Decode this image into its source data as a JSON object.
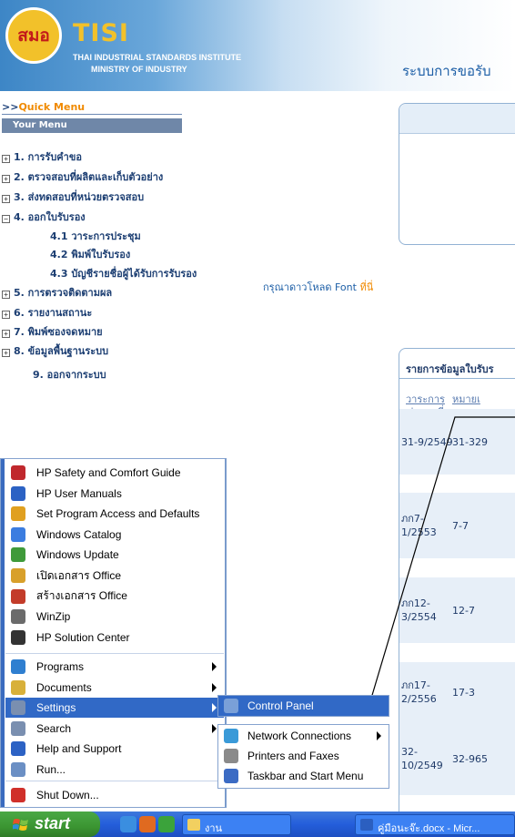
{
  "header": {
    "logo_text": "สมอ",
    "brand": "TISI",
    "institute": "THAI INDUSTRIAL STANDARDS INSTITUTE",
    "ministry": "MINISTRY OF INDUSTRY",
    "system_name": "ระบบการขอรับ"
  },
  "sidebar": {
    "quick_menu_prefix": ">>",
    "quick_menu": "Quick Menu",
    "your_menu": "Your Menu",
    "items": [
      {
        "label": "1. การรับคำขอ",
        "toggle": "+"
      },
      {
        "label": "2. ตรวจสอบที่ผลิตและเก็บตัวอย่าง",
        "toggle": "+"
      },
      {
        "label": "3. ส่งทดสอบที่หน่วยตรวจสอบ",
        "toggle": "+"
      },
      {
        "label": "4. ออกใบรับรอง",
        "toggle": "−"
      },
      {
        "label": "5. การตรวจติดตามผล",
        "toggle": "+"
      },
      {
        "label": "6. รายงานสถานะ",
        "toggle": "+"
      },
      {
        "label": "7. พิมพ์ซองจดหมาย",
        "toggle": "+"
      },
      {
        "label": "8. ข้อมูลพื้นฐานระบบ",
        "toggle": "+"
      },
      {
        "label": "9. ออกจากระบบ",
        "toggle": ""
      }
    ],
    "subitems": [
      "4.1 วาระการประชุม",
      "4.2 พิมพ์ใบรับรอง",
      "4.3 บัญชีรายชื่อผู้ได้รับการรับรอง"
    ]
  },
  "font_note": {
    "text": "กรุณาดาวโหลด Font ",
    "link": "ที่นี่"
  },
  "cert_panel": {
    "title": "รายการข้อมูลใบรับร",
    "columns": [
      [
        "วาระการ",
        "ประชุมที่"
      ],
      [
        "หมายเ",
        "เอกส"
      ]
    ],
    "rows": [
      {
        "c1": [
          "31-9/2549"
        ],
        "c2": "31-329"
      },
      {
        "c1": [
          "ภก7-",
          "1/2553"
        ],
        "c2": "7-7"
      },
      {
        "c1": [
          "ภก12-",
          "3/2554"
        ],
        "c2": "12-7"
      },
      {
        "c1": [
          "ภก17-",
          "2/2556"
        ],
        "c2": "17-3"
      },
      {
        "c1": [
          "32-",
          "10/2549"
        ],
        "c2": "32-965"
      }
    ]
  },
  "start_menu": {
    "pinned": [
      {
        "label": "HP Safety and Comfort Guide",
        "icon": "pdf-icon",
        "color": "#c0282d"
      },
      {
        "label": "HP User Manuals",
        "icon": "hp-icon",
        "color": "#2c62c4"
      },
      {
        "label": "Set Program Access and Defaults",
        "icon": "program-access-icon",
        "color": "#e0a020"
      },
      {
        "label": "Windows Catalog",
        "icon": "windows-catalog-icon",
        "color": "#3b7de0"
      },
      {
        "label": "Windows Update",
        "icon": "windows-update-icon",
        "color": "#3f9a3a"
      },
      {
        "label": "เปิดเอกสาร Office",
        "icon": "office-open-icon",
        "color": "#d8a02b"
      },
      {
        "label": "สร้างเอกสาร Office",
        "icon": "office-new-icon",
        "color": "#c33c2a"
      },
      {
        "label": "WinZip",
        "icon": "winzip-icon",
        "color": "#6b6b6b"
      },
      {
        "label": "HP Solution Center",
        "icon": "hp-solution-icon",
        "color": "#333333"
      }
    ],
    "main": [
      {
        "label": "Programs",
        "icon": "programs-icon",
        "color": "#2f7fd0",
        "arrow": true
      },
      {
        "label": "Documents",
        "icon": "documents-icon",
        "color": "#d8b03a",
        "arrow": true
      },
      {
        "label": "Settings",
        "icon": "settings-icon",
        "color": "#7a8fb0",
        "arrow": true
      },
      {
        "label": "Search",
        "icon": "search-icon",
        "color": "#7a8fb0",
        "arrow": true
      },
      {
        "label": "Help and Support",
        "icon": "help-icon",
        "color": "#2c62c4",
        "arrow": false
      },
      {
        "label": "Run...",
        "icon": "run-icon",
        "color": "#6b8fc4",
        "arrow": false
      }
    ],
    "shutdown": {
      "label": "Shut Down...",
      "icon": "shutdown-icon",
      "color": "#d0302a"
    }
  },
  "settings_submenu": {
    "items": [
      {
        "label": "Control Panel",
        "icon": "control-panel-icon",
        "color": "#7aa0d8",
        "arrow": false
      },
      {
        "label": "Network Connections",
        "icon": "network-icon",
        "color": "#3a9ad8",
        "arrow": true
      },
      {
        "label": "Printers and Faxes",
        "icon": "printer-icon",
        "color": "#8a8a8a",
        "arrow": false
      },
      {
        "label": "Taskbar and Start Menu",
        "icon": "taskbar-icon",
        "color": "#3b6bc4",
        "arrow": false
      }
    ]
  },
  "taskbar": {
    "start": "start",
    "quick_launch": [
      {
        "icon": "ie-icon",
        "color": "#3a8ee0"
      },
      {
        "icon": "firefox-icon",
        "color": "#e06a20"
      },
      {
        "icon": "calendar-icon",
        "color": "#3ba33b"
      }
    ],
    "buttons": [
      {
        "label": "งาน",
        "icon": "folder-icon",
        "color": "#f2d060"
      },
      {
        "label": "คู่มือนะจ๊ะ.docx - Micr...",
        "icon": "word-icon",
        "color": "#2b5fc0"
      }
    ]
  },
  "colors": {
    "highlight": "#3169c6",
    "accent": "#f08a00",
    "link": "#1c5ea6"
  }
}
